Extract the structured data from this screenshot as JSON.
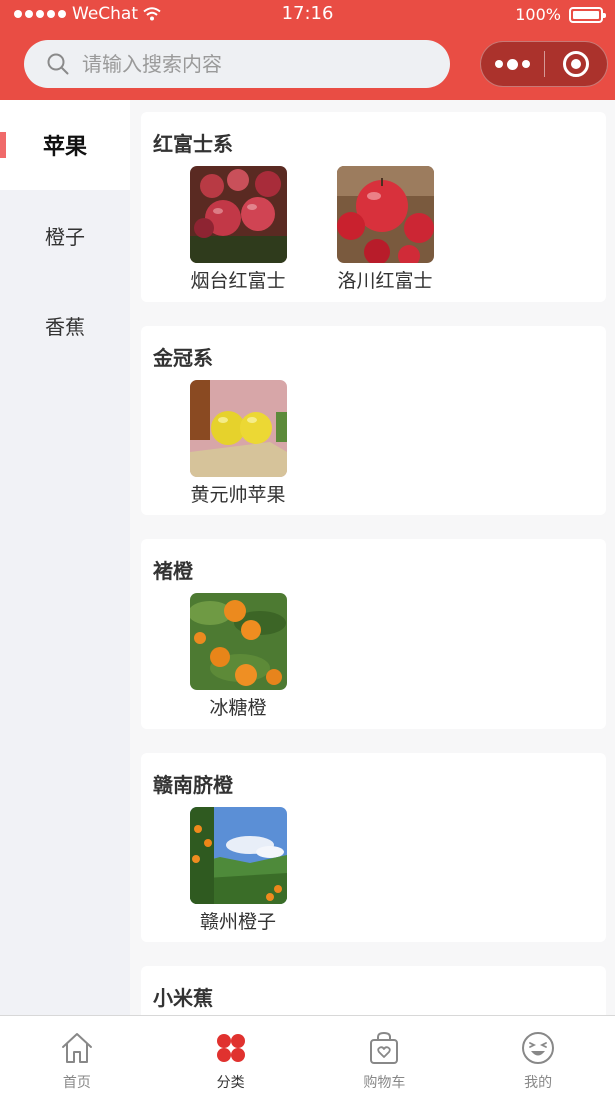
{
  "status_bar": {
    "carrier": "WeChat",
    "time": "17:16",
    "battery": "100%"
  },
  "search": {
    "placeholder": "请输入搜索内容",
    "icon": "search-icon"
  },
  "capsule": {
    "more_icon": "more-dots-icon",
    "close_icon": "target-close-icon"
  },
  "sidebar": {
    "items": [
      {
        "label": "苹果",
        "active": true
      },
      {
        "label": "橙子",
        "active": false
      },
      {
        "label": "香蕉",
        "active": false
      }
    ]
  },
  "groups": [
    {
      "title": "红富士系",
      "products": [
        {
          "name": "烟台红富士"
        },
        {
          "name": "洛川红富士"
        }
      ]
    },
    {
      "title": "金冠系",
      "products": [
        {
          "name": "黄元帅苹果"
        }
      ]
    },
    {
      "title": "褚橙",
      "products": [
        {
          "name": "冰糖橙"
        }
      ]
    },
    {
      "title": "赣南脐橙",
      "products": [
        {
          "name": "赣州橙子"
        }
      ]
    },
    {
      "title": "小米蕉",
      "products": []
    }
  ],
  "tabbar": {
    "tabs": [
      {
        "label": "首页",
        "icon": "home-icon"
      },
      {
        "label": "分类",
        "icon": "category-icon",
        "active": true
      },
      {
        "label": "购物车",
        "icon": "shopping-bag-icon"
      },
      {
        "label": "我的",
        "icon": "smiley-face-icon"
      }
    ]
  },
  "colors": {
    "brand": "#e94d44",
    "sidebar_active_marker": "#f06a6a"
  }
}
